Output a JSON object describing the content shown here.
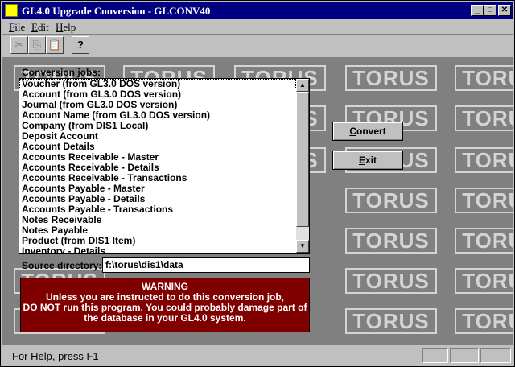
{
  "window": {
    "title": "GL4.0 Upgrade Conversion - GLCONV40",
    "minimize_glyph": "_",
    "maximize_glyph": "□",
    "close_glyph": "✕"
  },
  "menu": [
    {
      "hotkey": "F",
      "rest": "ile"
    },
    {
      "hotkey": "E",
      "rest": "dit"
    },
    {
      "hotkey": "H",
      "rest": "elp"
    }
  ],
  "toolbar": {
    "cut_icon": "✂",
    "copy_icon": "⎘",
    "paste_icon": "📋",
    "help_icon": "?"
  },
  "background": {
    "logo_text": "TORUS"
  },
  "jobs": {
    "label": "Conversion jobs:",
    "items": [
      "Voucher (from GL3.0 DOS version)",
      "Account (from GL3.0 DOS version)",
      "Journal (from GL3.0 DOS version)",
      "Account Name (from GL3.0 DOS version)",
      "Company (from DIS1 Local)",
      "Deposit Account",
      "Account Details",
      "Accounts Receivable - Master",
      "Accounts Receivable - Details",
      "Accounts Receivable - Transactions",
      "Accounts Payable - Master",
      "Accounts Payable - Details",
      "Accounts Payable - Transactions",
      "Notes Receivable",
      "Notes Payable",
      "Product (from DIS1 Item)",
      "Inventory - Details"
    ],
    "scroll_up": "▲",
    "scroll_down": "▼"
  },
  "buttons": {
    "convert_hotkey": "C",
    "convert_rest": "onvert",
    "exit_hotkey": "E",
    "exit_rest": "xit"
  },
  "source": {
    "label": "Source directory:",
    "value": "f:\\torus\\dis1\\data"
  },
  "warning": {
    "title": "WARNING",
    "lines": [
      "Unless you are instructed to do this conversion job,",
      "DO NOT run this program. You could probably damage part of",
      "the database in your GL4.0 system."
    ]
  },
  "status": {
    "text": "For Help, press F1"
  },
  "colors": {
    "titlebar": "#000080",
    "warning_bg": "#800000",
    "client_bg": "#808080"
  }
}
